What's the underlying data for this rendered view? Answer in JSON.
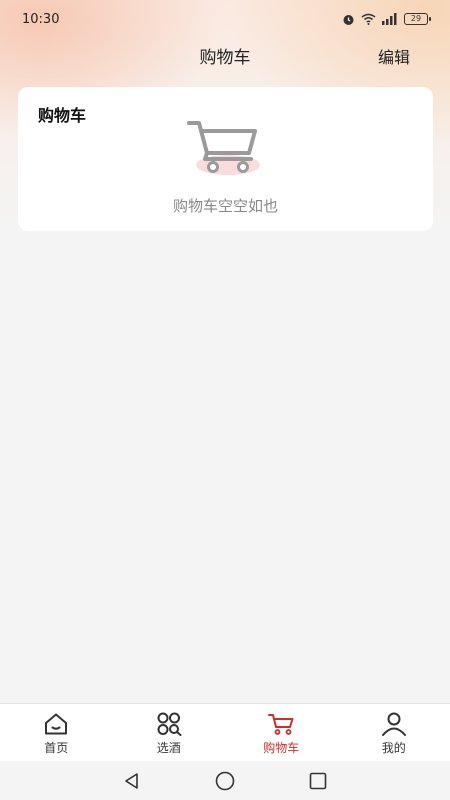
{
  "status_bar": {
    "time": "10:30",
    "battery": "29"
  },
  "header": {
    "title": "购物车",
    "edit_label": "编辑"
  },
  "cart_card": {
    "title": "购物车",
    "empty_text": "购物车空空如也"
  },
  "tab_bar": {
    "items": [
      {
        "label": "首页",
        "icon": "home-icon",
        "active": false
      },
      {
        "label": "选酒",
        "icon": "grid-search-icon",
        "active": false
      },
      {
        "label": "购物车",
        "icon": "cart-icon",
        "active": true
      },
      {
        "label": "我的",
        "icon": "person-icon",
        "active": false
      }
    ]
  },
  "colors": {
    "accent": "#c8302c",
    "background": "#f4f4f4",
    "card": "#ffffff"
  }
}
